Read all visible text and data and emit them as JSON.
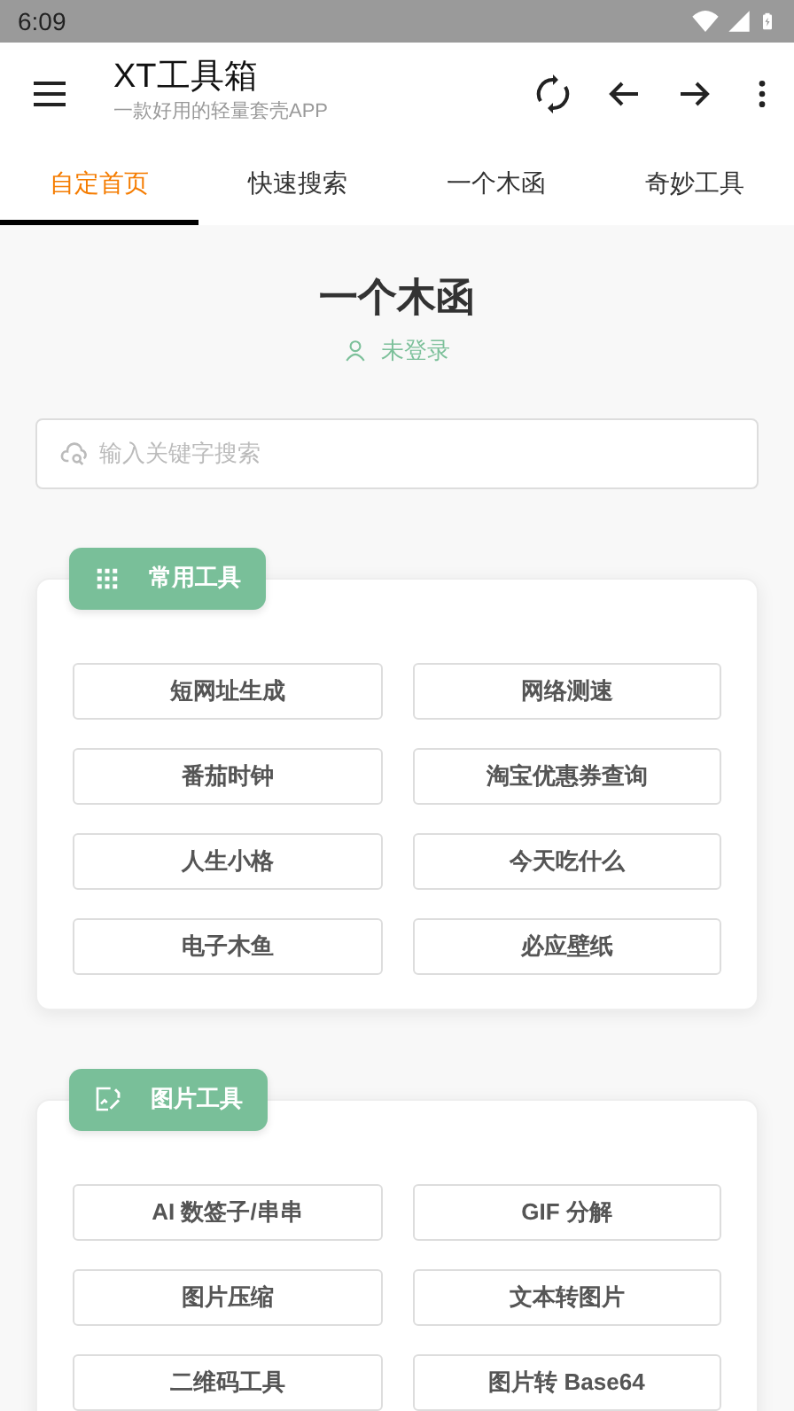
{
  "status_bar": {
    "time": "6:09"
  },
  "app_bar": {
    "title": "XT工具箱",
    "subtitle": "一款好用的轻量套壳APP"
  },
  "tabs": [
    {
      "label": "自定首页",
      "selected": true
    },
    {
      "label": "快速搜索",
      "selected": false
    },
    {
      "label": "一个木函",
      "selected": false
    },
    {
      "label": "奇妙工具",
      "selected": false
    }
  ],
  "header": {
    "title": "一个木函",
    "login_status": "未登录"
  },
  "search": {
    "placeholder": "输入关键字搜索"
  },
  "sections": [
    {
      "title": "常用工具",
      "kind": "grid",
      "tools": [
        "短网址生成",
        "网络测速",
        "番茄时钟",
        "淘宝优惠券查询",
        "人生小格",
        "今天吃什么",
        "电子木鱼",
        "必应壁纸"
      ]
    },
    {
      "title": "图片工具",
      "kind": "image",
      "tools": [
        "AI 数签子/串串",
        "GIF 分解",
        "图片压缩",
        "文本转图片",
        "二维码工具",
        "图片转 Base64"
      ]
    }
  ]
}
